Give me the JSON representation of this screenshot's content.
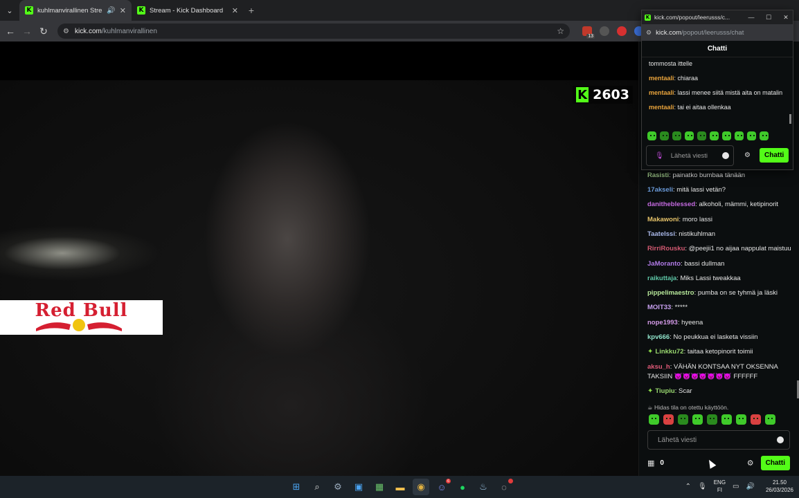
{
  "browser": {
    "tabs": [
      {
        "title": "kuhlmanvirallinen Stream -",
        "active": true
      },
      {
        "title": "Stream - Kick Dashboard",
        "active": false
      }
    ],
    "url_host": "kick.com",
    "url_path": "/kuhlmanvirallinen",
    "extension_badge": "13"
  },
  "stream": {
    "viewer_count": "2603",
    "brand_logo_text": "Red Bull"
  },
  "popout": {
    "window_title": "kick.com/popout/leerusss/c...",
    "url_host": "kick.com",
    "url_path": "/popout/leerusss/chat",
    "header": "Chatti",
    "messages": [
      {
        "user": "",
        "text": "tommosta ittelle"
      },
      {
        "user": "mentaali",
        "text": "chiaraa"
      },
      {
        "user": "mentaali",
        "text": "lassi menee siitä mistä aita on matalin"
      },
      {
        "user": "mentaali",
        "text": "tai ei aitaa ollenkaa"
      }
    ],
    "input_placeholder": "Lähetä viesti",
    "send_label": "Chatti"
  },
  "chat": {
    "messages": [
      {
        "user": "Rasisti",
        "text": "painatko bumbaa tänään",
        "color": "#9fc98a"
      },
      {
        "user": "17akseli",
        "text": "mitä lassi vetän?",
        "color": "#6a9ad8"
      },
      {
        "user": "danitheblessed",
        "text": "alkoholi, mämmi, ketipinorit",
        "color": "#c46ae0"
      },
      {
        "user": "Makawoni",
        "text": "moro lassi",
        "color": "#e6c36a"
      },
      {
        "user": "Taatelssi",
        "text": "nistikuhlman",
        "color": "#a9b8e8"
      },
      {
        "user": "RirriRousku",
        "text": "@peejii1 no aijaa nappulat maistuu",
        "color": "#d45a72"
      },
      {
        "user": "JaMoranto",
        "text": "bassi dullman",
        "color": "#b07ae6"
      },
      {
        "user": "raikuttaja",
        "text": "Miks Lassi tweakkaa",
        "color": "#5fc8a8"
      },
      {
        "user": "pippelimaestro",
        "text": "pumba on se tyhmä ja läski",
        "color": "#b7e89a"
      },
      {
        "user": "MOIT33",
        "text": "*****",
        "color": "#c7a0f0"
      },
      {
        "user": "nope1993",
        "text": "hyeena",
        "color": "#d49ae8"
      },
      {
        "user": "kpv666",
        "text": "No peukkua ei lasketa vissiin",
        "color": "#8ee0c8"
      },
      {
        "user": "Linkku72",
        "text": "taitaa ketopinorit toimii",
        "color": "#9ad870",
        "badge": "✦"
      },
      {
        "user": "aksu_h",
        "text": "VÄHÄN KONTSAA NYT OKSENNA TAKSIIN 👿👿👿👿👿👿👿 FFFFFF",
        "color": "#e05a78"
      },
      {
        "user": "Tiupiu",
        "text": "Scar",
        "color": "#9ad870",
        "badge": "✦"
      }
    ],
    "slow_mode_note": "Hidas tila on otettu käyttöön.",
    "input_placeholder": "Lähetä viesti",
    "gift_count": "0",
    "send_label": "Chatti"
  },
  "taskbar": {
    "discord_badge": "6",
    "language": "ENG",
    "region": "FI",
    "time": "21.50",
    "date": "26/03/2026"
  },
  "colors": {
    "kick_green": "#53fc18",
    "redbull_red": "#d51f31",
    "popout_user": "#e8a33c"
  }
}
